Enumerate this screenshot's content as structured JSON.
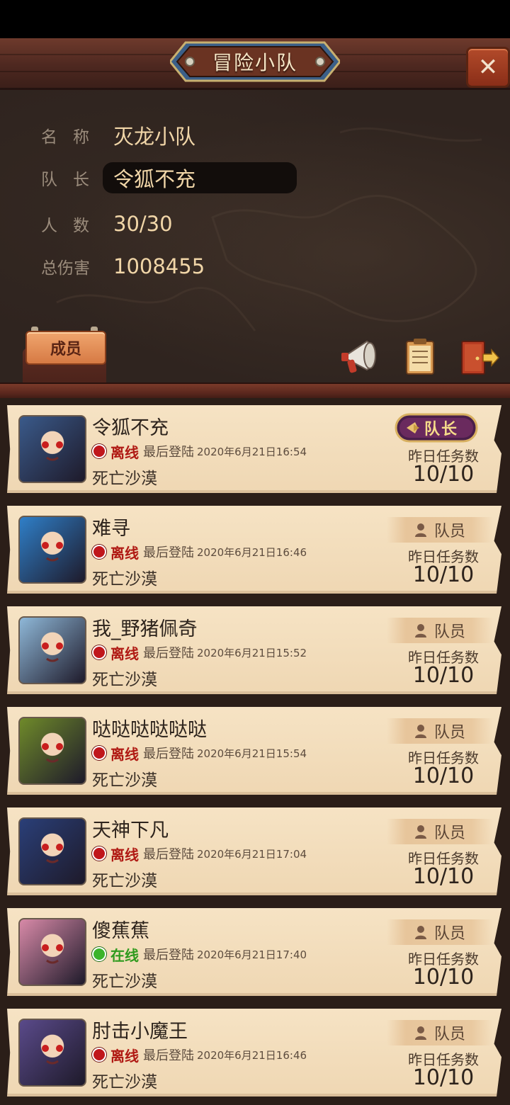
{
  "header": {
    "title": "冒险小队",
    "close_label": "✕"
  },
  "team": {
    "name_label": "名称",
    "name_value": "灭龙小队",
    "leader_label": "队长",
    "leader_value": "令狐不充",
    "count_label": "人数",
    "count_value": "30/30",
    "damage_label": "总伤害",
    "damage_value": "1008455"
  },
  "tabs": {
    "members": "成员"
  },
  "icons": [
    "megaphone-icon",
    "notice-board-icon",
    "exit-door-icon"
  ],
  "common": {
    "last_login_label": "最后登陆",
    "task_label": "昨日任务数",
    "leader_badge": "队长",
    "member_badge": "队员"
  },
  "members": [
    {
      "name": "令狐不充",
      "status": "离线",
      "online": false,
      "last_login": "2020年6月21日16:54",
      "location": "死亡沙漠",
      "role": "leader",
      "tasks": "10/10",
      "avatar_color": "#3a5a8a"
    },
    {
      "name": "难寻",
      "status": "离线",
      "online": false,
      "last_login": "2020年6月21日16:46",
      "location": "死亡沙漠",
      "role": "member",
      "tasks": "10/10",
      "avatar_color": "#2f7fc8"
    },
    {
      "name": "我_野猪佩奇",
      "status": "离线",
      "online": false,
      "last_login": "2020年6月21日15:52",
      "location": "死亡沙漠",
      "role": "member",
      "tasks": "10/10",
      "avatar_color": "#8fb8d8"
    },
    {
      "name": "哒哒哒哒哒哒",
      "status": "离线",
      "online": false,
      "last_login": "2020年6月21日15:54",
      "location": "死亡沙漠",
      "role": "member",
      "tasks": "10/10",
      "avatar_color": "#6f8a2a"
    },
    {
      "name": "天神下凡",
      "status": "离线",
      "online": false,
      "last_login": "2020年6月21日17:04",
      "location": "死亡沙漠",
      "role": "member",
      "tasks": "10/10",
      "avatar_color": "#2a3f78"
    },
    {
      "name": "傻蕉蕉",
      "status": "在线",
      "online": true,
      "last_login": "2020年6月21日17:40",
      "location": "死亡沙漠",
      "role": "member",
      "tasks": "10/10",
      "avatar_color": "#d88aa8"
    },
    {
      "name": "肘击小魔王",
      "status": "离线",
      "online": false,
      "last_login": "2020年6月21日16:46",
      "location": "死亡沙漠",
      "role": "member",
      "tasks": "10/10",
      "avatar_color": "#5a4a8a"
    }
  ]
}
